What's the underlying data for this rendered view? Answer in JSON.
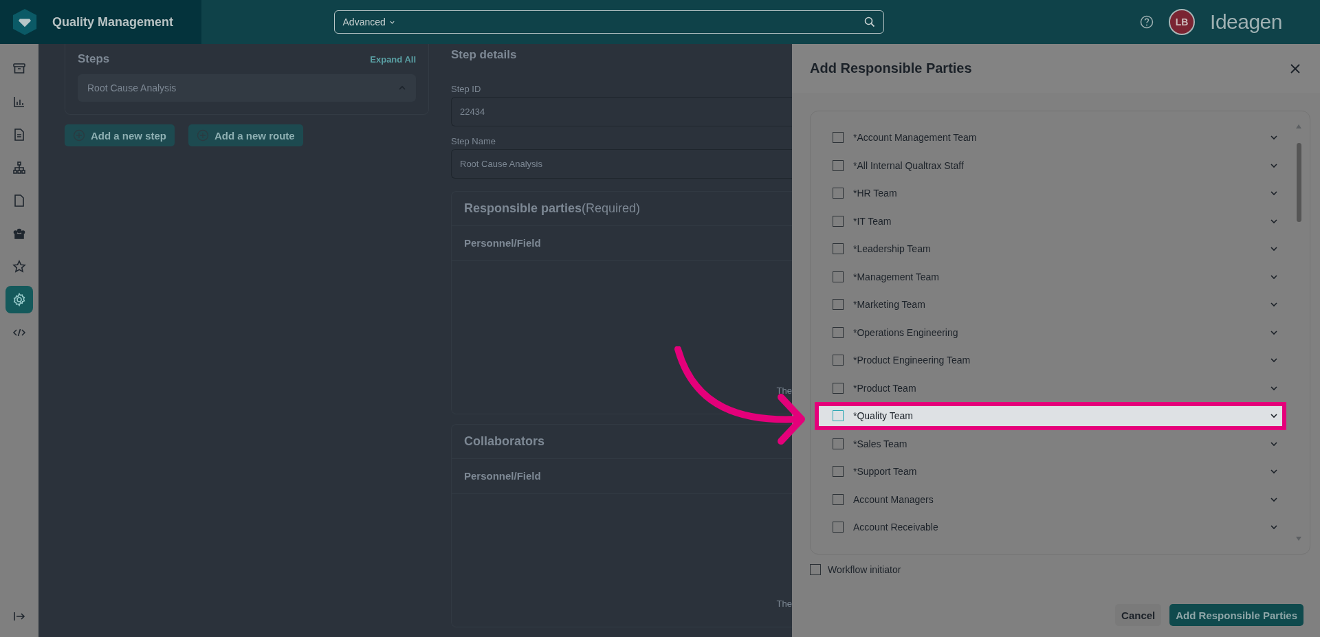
{
  "app": {
    "title": "Quality Management"
  },
  "search": {
    "filter": "Advanced"
  },
  "user": {
    "initials": "LB"
  },
  "brand": "Ideagen",
  "sidebar": [
    {
      "kind": "archive",
      "selected": false
    },
    {
      "kind": "chart",
      "selected": false
    },
    {
      "kind": "document",
      "selected": false
    },
    {
      "kind": "hierarchy",
      "selected": false
    },
    {
      "kind": "file",
      "selected": false
    },
    {
      "kind": "team",
      "selected": false
    },
    {
      "kind": "star",
      "selected": false
    },
    {
      "kind": "settings",
      "selected": true
    },
    {
      "kind": "code",
      "selected": false
    }
  ],
  "steps_panel": {
    "title": "Steps",
    "expand": "Expand All",
    "steps": [
      {
        "name": "Root Cause Analysis",
        "expanded": true
      }
    ],
    "buttons": [
      "Add a new step",
      "Add a new route"
    ]
  },
  "step_details": {
    "title": "Step details",
    "fields": [
      {
        "label": "Step ID",
        "value": "22434"
      },
      {
        "label": "Step Name",
        "value": "Root Cause Analysis"
      }
    ],
    "sections": [
      {
        "title": "Responsible parties",
        "note": "(Required)",
        "column": "Personnel/Field",
        "footer": "The"
      },
      {
        "title": "Collaborators",
        "column": "Personnel/Field",
        "footer": "The"
      }
    ]
  },
  "drawer": {
    "title": "Add Responsible Parties",
    "items": [
      {
        "label": "*Account Management Team",
        "checked": false,
        "highlighted": false
      },
      {
        "label": "*All Internal Qualtrax Staff",
        "checked": false,
        "highlighted": false
      },
      {
        "label": "*HR Team",
        "checked": false,
        "highlighted": false
      },
      {
        "label": "*IT Team",
        "checked": false,
        "highlighted": false
      },
      {
        "label": "*Leadership Team",
        "checked": false,
        "highlighted": false
      },
      {
        "label": "*Management Team",
        "checked": false,
        "highlighted": false
      },
      {
        "label": "*Marketing Team",
        "checked": false,
        "highlighted": false
      },
      {
        "label": "*Operations Engineering",
        "checked": false,
        "highlighted": false
      },
      {
        "label": "*Product Engineering Team",
        "checked": false,
        "highlighted": false
      },
      {
        "label": "*Product Team",
        "checked": false,
        "highlighted": false
      },
      {
        "label": "*Quality Team",
        "checked": false,
        "highlighted": true
      },
      {
        "label": "*Sales Team",
        "checked": false,
        "highlighted": false
      },
      {
        "label": "*Support Team",
        "checked": false,
        "highlighted": false
      },
      {
        "label": "Account Managers",
        "checked": false,
        "highlighted": false
      },
      {
        "label": "Account Receivable",
        "checked": false,
        "highlighted": false
      }
    ],
    "workflow_initiator": {
      "label": "Workflow initiator",
      "checked": false
    },
    "buttons": [
      {
        "label": "Cancel",
        "kind": "secondary"
      },
      {
        "label": "Add Responsible Parties",
        "kind": "primary"
      }
    ]
  }
}
